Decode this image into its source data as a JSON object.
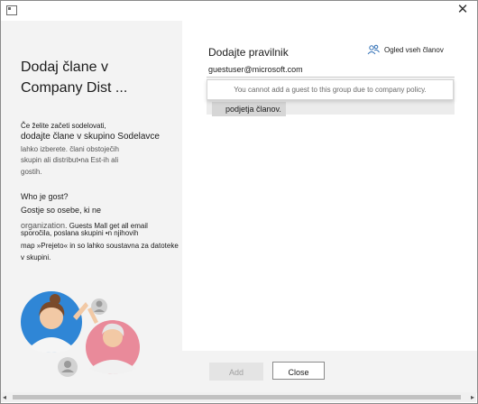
{
  "window": {
    "app_icon": "window-app-icon",
    "close_symbol": "✕"
  },
  "left": {
    "heading_line1": "Dodaj člane v",
    "heading_line2": "Company Dist ...",
    "para1_line1": "Če želite začeti sodelovati,",
    "para1_line2": "dodajte člane v skupino Sodelavce",
    "para1_line3": "lahko izberete.  člani obstoječih",
    "para1_line4": "skupin ali distribut•na Est-ih ali",
    "para1_line5": "gostih.",
    "who_title": "Who je gost?",
    "para2_line1": "Gostje so osebe, ki ne",
    "para2_line2a": "organization.",
    "para2_line2b": " Guests Mall get all email",
    "para2_line3": "sporočila, poslana skupini •n njihovih",
    "para2_line4": "map »Prejeto« in so lahko soustavna za datoteke",
    "para2_line5": "v skupini."
  },
  "right": {
    "title": "Dodajte pravilnik",
    "view_members_icon": "people-icon",
    "view_members": "Ogled vseh članov",
    "input_value": "guestuser@microsoft.com",
    "tooltip": "You cannot add a guest to this group due to company policy.",
    "highlight_text": "podjetja članov."
  },
  "footer": {
    "add_label": "Add",
    "close_label": "Close"
  },
  "colors": {
    "left_pane_bg": "#f3f3f3",
    "disabled_button_bg": "#e4e4e4",
    "illustration_blue": "#2f86d6",
    "illustration_pink": "#e98a9a"
  }
}
